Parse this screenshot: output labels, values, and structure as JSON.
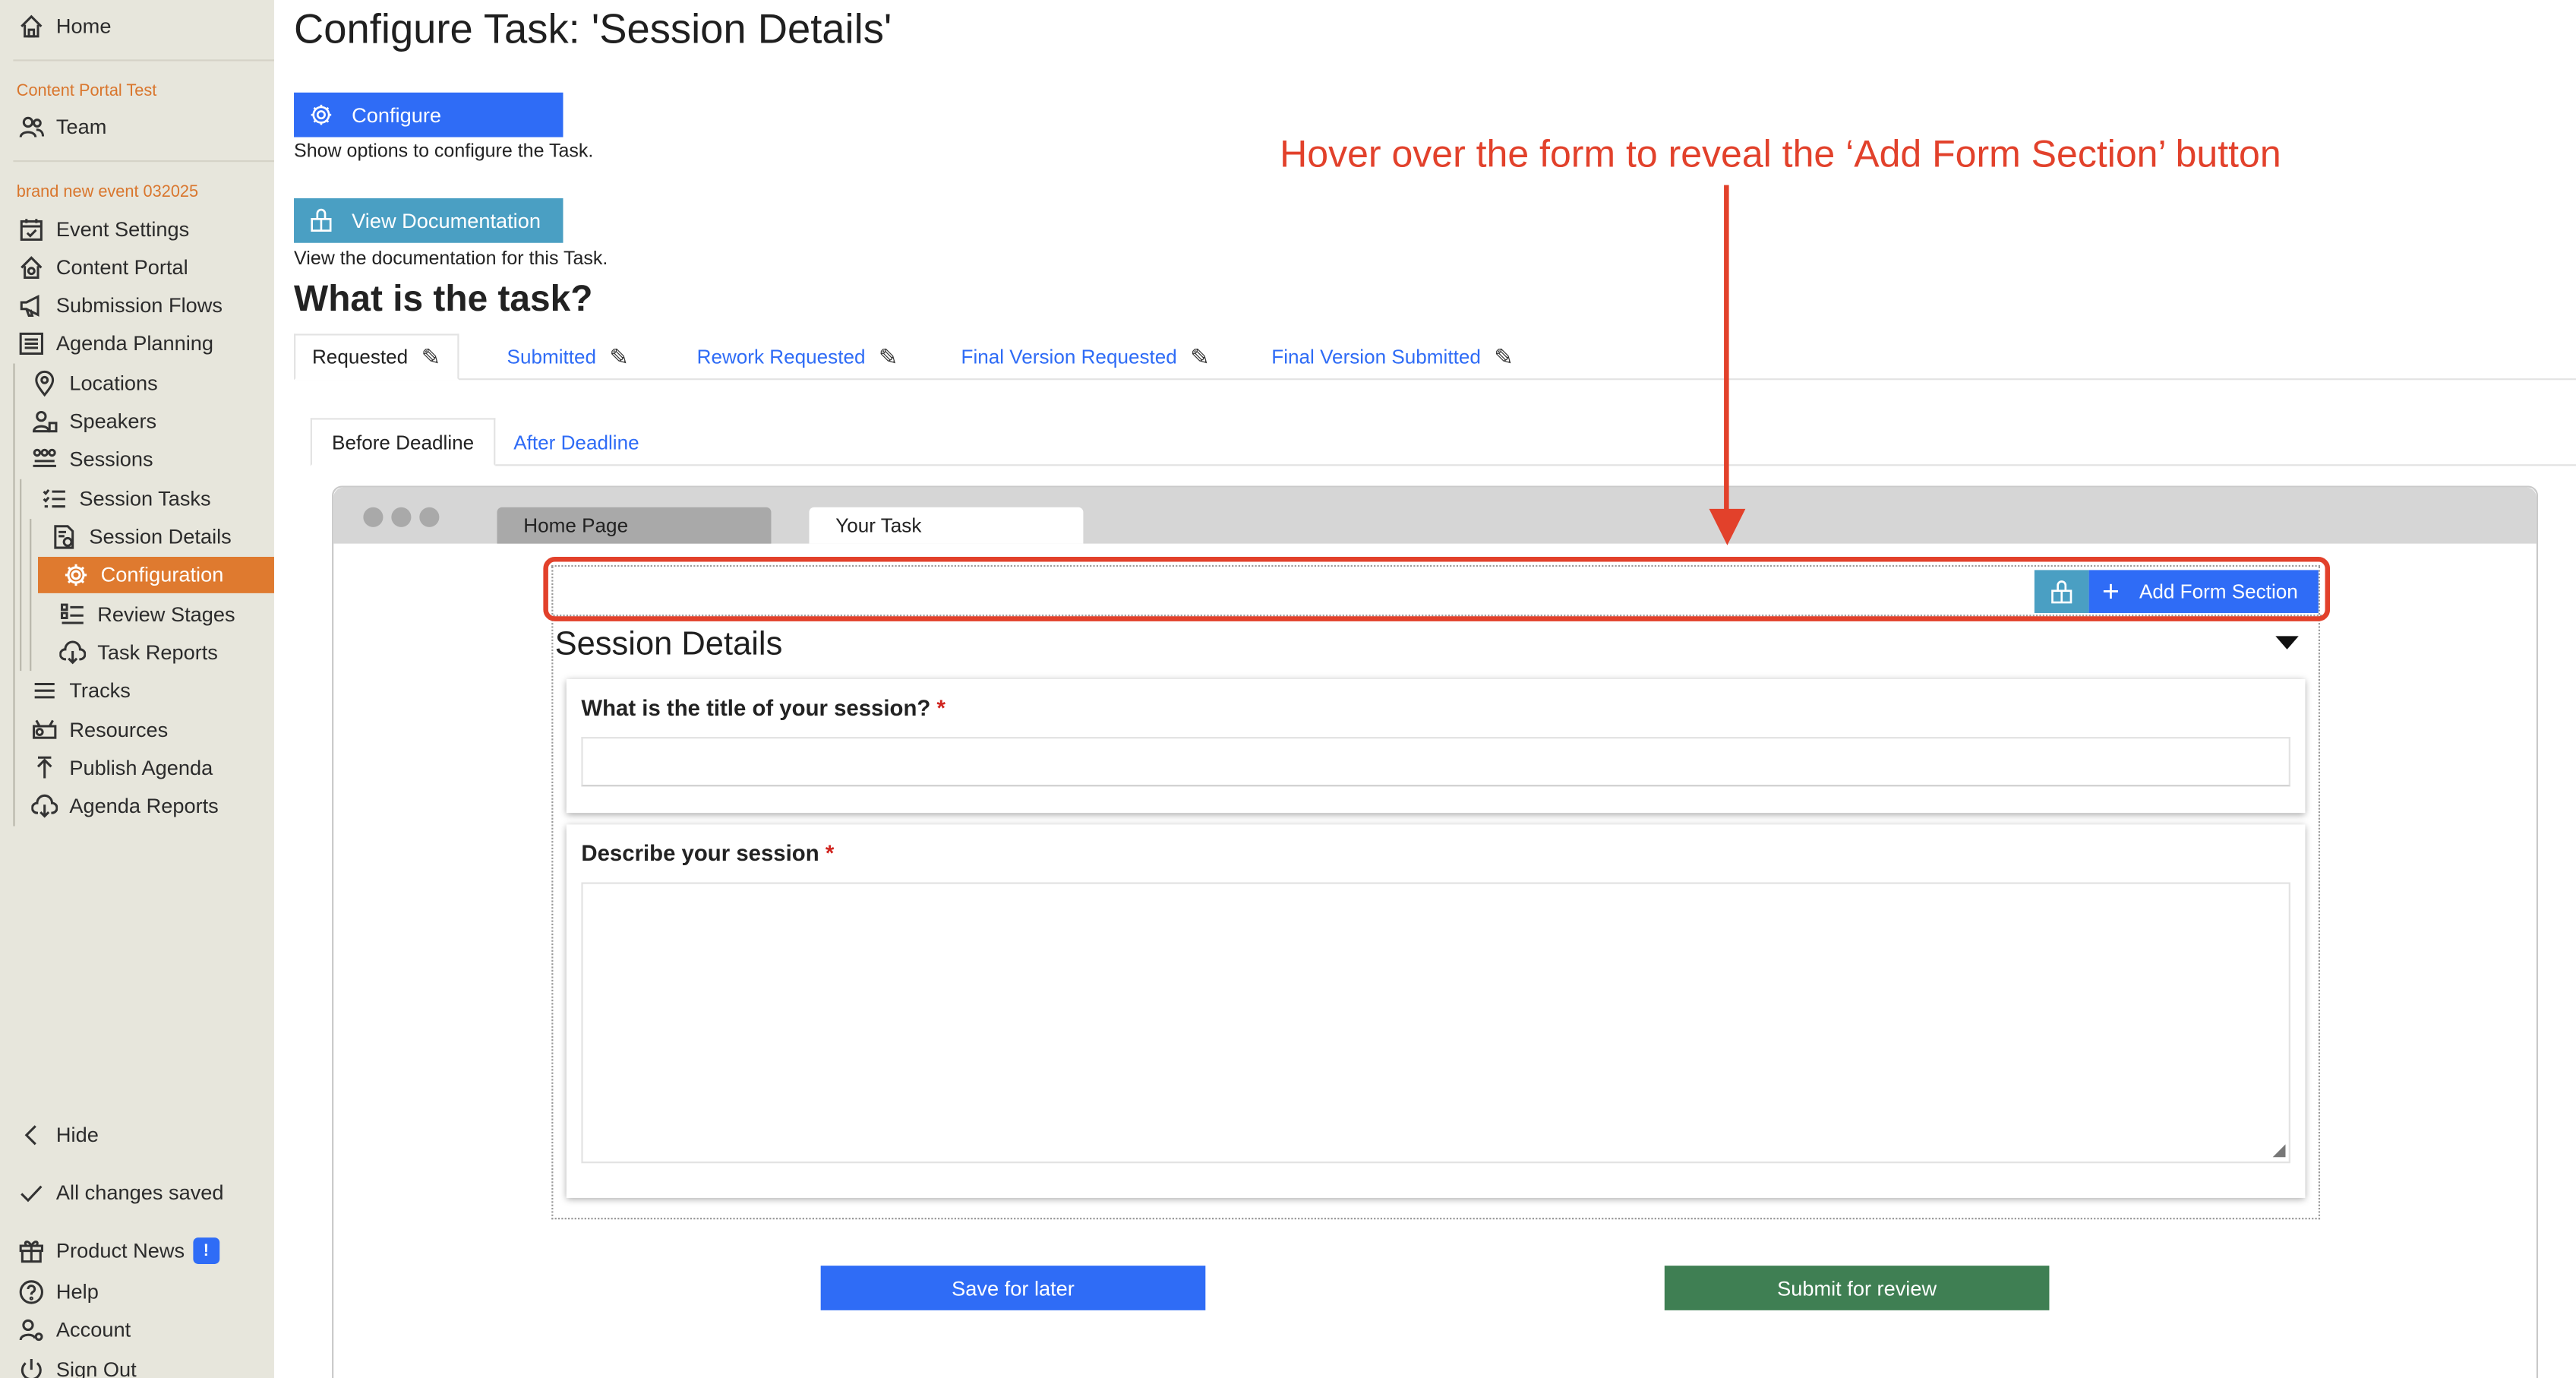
{
  "sidebar": {
    "home": "Home",
    "org_label": "Content Portal Test",
    "team": "Team",
    "event_label": "brand new event 032025",
    "items": [
      {
        "label": "Event Settings",
        "icon": "calendar-check-icon"
      },
      {
        "label": "Content Portal",
        "icon": "house-gear-icon"
      },
      {
        "label": "Submission Flows",
        "icon": "megaphone-icon"
      },
      {
        "label": "Agenda Planning",
        "icon": "list-icon"
      },
      {
        "label": "Locations",
        "icon": "map-pin-icon"
      },
      {
        "label": "Speakers",
        "icon": "speaker-icon"
      },
      {
        "label": "Sessions",
        "icon": "people-group-icon"
      },
      {
        "label": "Session Tasks",
        "icon": "checklist-icon"
      },
      {
        "label": "Session Details",
        "icon": "document-gear-icon"
      },
      {
        "label": "Configuration",
        "icon": "gear-icon"
      },
      {
        "label": "Review Stages",
        "icon": "review-list-icon"
      },
      {
        "label": "Task Reports",
        "icon": "cloud-download-icon"
      },
      {
        "label": "Tracks",
        "icon": "lines-icon"
      },
      {
        "label": "Resources",
        "icon": "projector-icon"
      },
      {
        "label": "Publish Agenda",
        "icon": "upload-arrow-icon"
      },
      {
        "label": "Agenda Reports",
        "icon": "cloud-download-icon"
      }
    ],
    "hide": "Hide",
    "saved": "All changes saved",
    "product_news": "Product News",
    "news_badge": "!",
    "help": "Help",
    "account": "Account",
    "sign_out": "Sign Out",
    "active_color": "#df7a2f"
  },
  "main": {
    "title": "Configure Task: 'Session Details'",
    "configure_btn": "Configure",
    "configure_help": "Show options to configure the Task.",
    "docs_btn": "View Documentation",
    "docs_help": "View the documentation for this Task.",
    "what_heading": "What is the task?",
    "tabs": [
      "Requested",
      "Submitted",
      "Rework Requested",
      "Final Version Requested",
      "Final Version Submitted"
    ],
    "subtabs": [
      "Before Deadline",
      "After Deadline"
    ]
  },
  "browser": {
    "tabs": [
      "Home Page",
      "Your Task"
    ],
    "add_section_btn": "Add Form Section",
    "section_title": "Session Details",
    "q1": "What is the title of your session?",
    "q2": "Describe your session",
    "required_mark": "*",
    "save_btn": "Save for later",
    "submit_btn": "Submit for review"
  },
  "annotation": {
    "text": "Hover over the form to reveal the ‘Add Form Section’ button",
    "color": "#e2412b"
  },
  "colors": {
    "primary_blue": "#2f6cf6",
    "teal": "#4a9fc3",
    "green": "#3f7f53"
  }
}
